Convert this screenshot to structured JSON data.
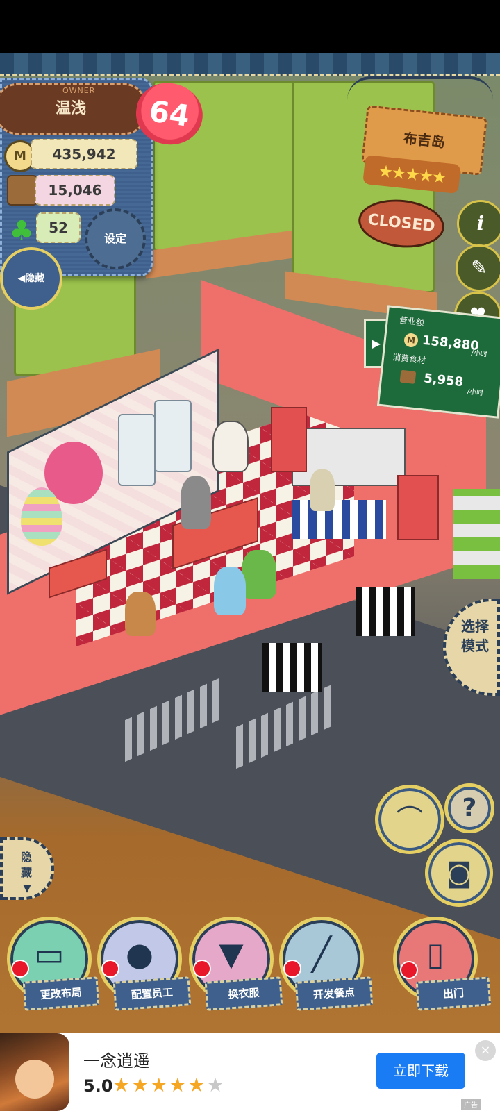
{
  "owner": {
    "tag": "OWNER",
    "name": "温浅",
    "level": "64",
    "coins": "435,942",
    "food": "15,046",
    "clover": "52",
    "settings_label": "设定",
    "hide_label": "隐藏"
  },
  "shop": {
    "name": "布吉岛",
    "stars": "★★★★★",
    "status": "CLOSED"
  },
  "revenue": {
    "sales_label": "营业额",
    "sales_value": "158,880",
    "sales_unit": "/小时",
    "consume_label": "消费食材",
    "consume_value": "5,958",
    "consume_unit": "/小时"
  },
  "side_buttons": {
    "info": "i",
    "help": "?",
    "select_mode": "选择模式"
  },
  "hide_bottom_label": "隐藏",
  "menu": [
    {
      "label": "更改布局",
      "icon": "table-icon"
    },
    {
      "label": "配置员工",
      "icon": "bear-head-icon"
    },
    {
      "label": "换衣服",
      "icon": "shirt-icon"
    },
    {
      "label": "开发餐点",
      "icon": "knife-icon"
    },
    {
      "label": "出门",
      "icon": "door-icon"
    }
  ],
  "ad": {
    "title": "一念逍遥",
    "rating": "5.0",
    "stars_filled": "★★★★★",
    "download_label": "立即下载",
    "close": "×",
    "tag": "广告"
  },
  "colors": {
    "denim": "#3f5f8c",
    "gold_border": "#e6cf62",
    "floor_pink": "#ef6f6a",
    "ad_button": "#1a7cf5"
  }
}
